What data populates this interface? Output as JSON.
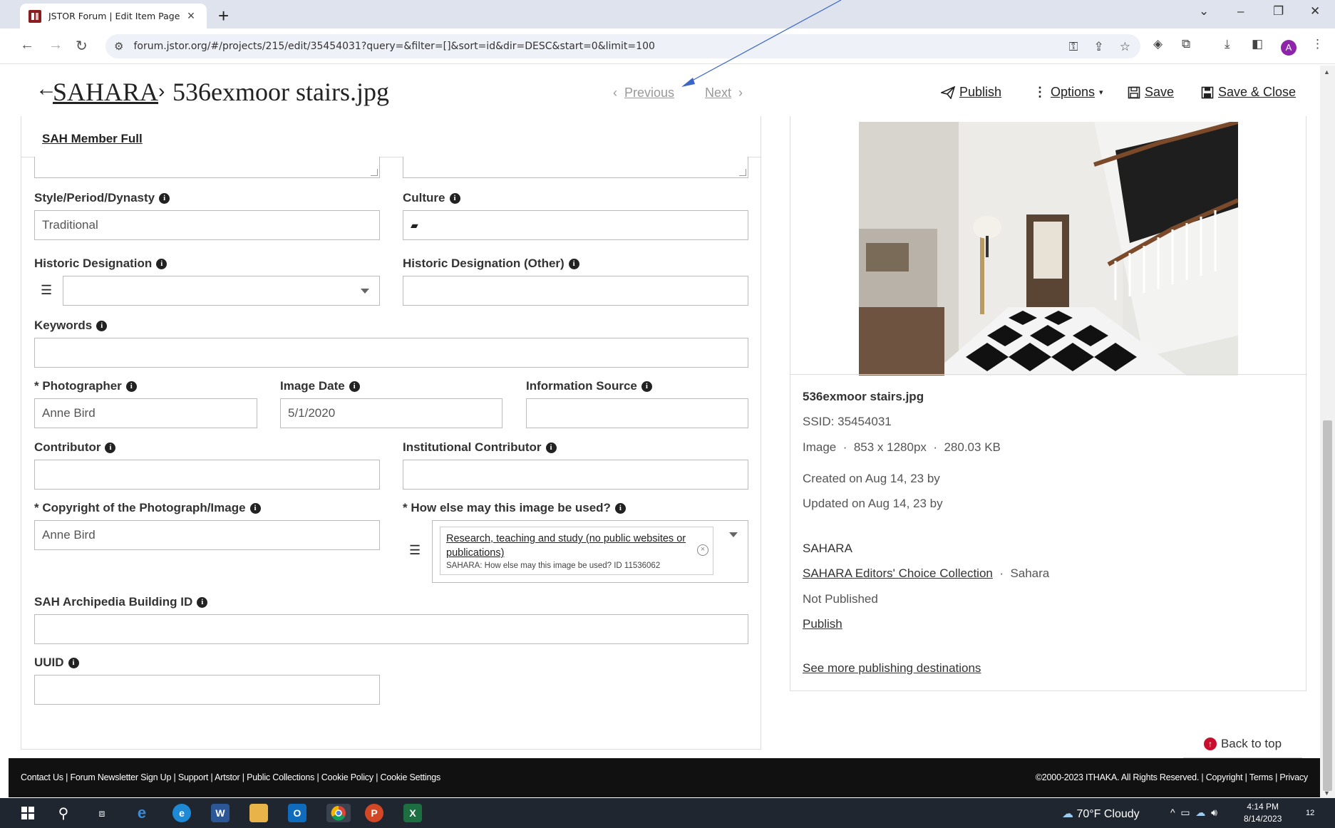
{
  "browser": {
    "tab_title": "JSTOR Forum | Edit Item Page",
    "url": "forum.jstor.org/#/projects/215/edit/35454031?query=&filter=[]&sort=id&dir=DESC&start=0&limit=100",
    "profile_initial": "A"
  },
  "header": {
    "breadcrumb_link": "SAHARA",
    "title": "536exmoor stairs.jpg",
    "previous_label": "Previous",
    "next_label": "Next",
    "publish_label": "Publish",
    "options_label": "Options",
    "save_label": "Save",
    "save_close_label": "Save & Close"
  },
  "form": {
    "member_link": "SAH Member Full",
    "style_label": "Style/Period/Dynasty",
    "style_value": "Traditional",
    "culture_label": "Culture",
    "historic_designation_label": "Historic Designation",
    "historic_designation_other_label": "Historic Designation (Other)",
    "keywords_label": "Keywords",
    "photographer_label": "* Photographer",
    "photographer_value": "Anne Bird",
    "image_date_label": "Image Date",
    "image_date_value": "5/1/2020",
    "information_source_label": "Information Source",
    "contributor_label": "Contributor",
    "institutional_contributor_label": "Institutional Contributor",
    "copyright_label": "* Copyright of the Photograph/Image",
    "copyright_value": "Anne Bird",
    "usage_label": "* How else may this image be used?",
    "usage_tag": "Research, teaching and study (no public websites or publications)",
    "usage_tag_sub": "SAHARA: How else may this image be used? ID 11536062",
    "archipedia_label": "SAH Archipedia Building ID",
    "uuid_label": "UUID"
  },
  "preview": {
    "filename": "536exmoor stairs.jpg",
    "ssid": "SSID: 35454031",
    "type": "Image",
    "dimensions": "853 x 1280px",
    "size": "280.03 KB",
    "created": "Created on Aug 14, 23 by",
    "updated": "Updated on Aug 14, 23 by",
    "project": "SAHARA",
    "collection_link": "SAHARA Editors' Choice Collection",
    "collection_owner": "Sahara",
    "status": "Not Published",
    "publish_link": "Publish",
    "more_destinations": "See more publishing destinations",
    "back_to_top": "Back to top"
  },
  "footer": {
    "links": [
      "Contact Us",
      "Forum Newsletter Sign Up",
      "Support",
      "Artstor",
      "Public Collections",
      "Cookie Policy",
      "Cookie Settings"
    ],
    "copyright": "©2000-2023 ITHAKA. All Rights Reserved.",
    "right_links": [
      "Copyright",
      "Terms",
      "Privacy"
    ]
  },
  "taskbar": {
    "weather": "70°F  Cloudy",
    "time": "4:14 PM",
    "date": "8/14/2023",
    "notification_count": "12"
  },
  "icons": {
    "info": "info-circle-icon",
    "list": "list-icon",
    "publish": "paper-plane-icon",
    "save": "floppy-disk-icon"
  },
  "colors": {
    "accent_red": "#c8102e",
    "footer_bg": "#111111",
    "annotation_arrow": "#3a66c8"
  }
}
